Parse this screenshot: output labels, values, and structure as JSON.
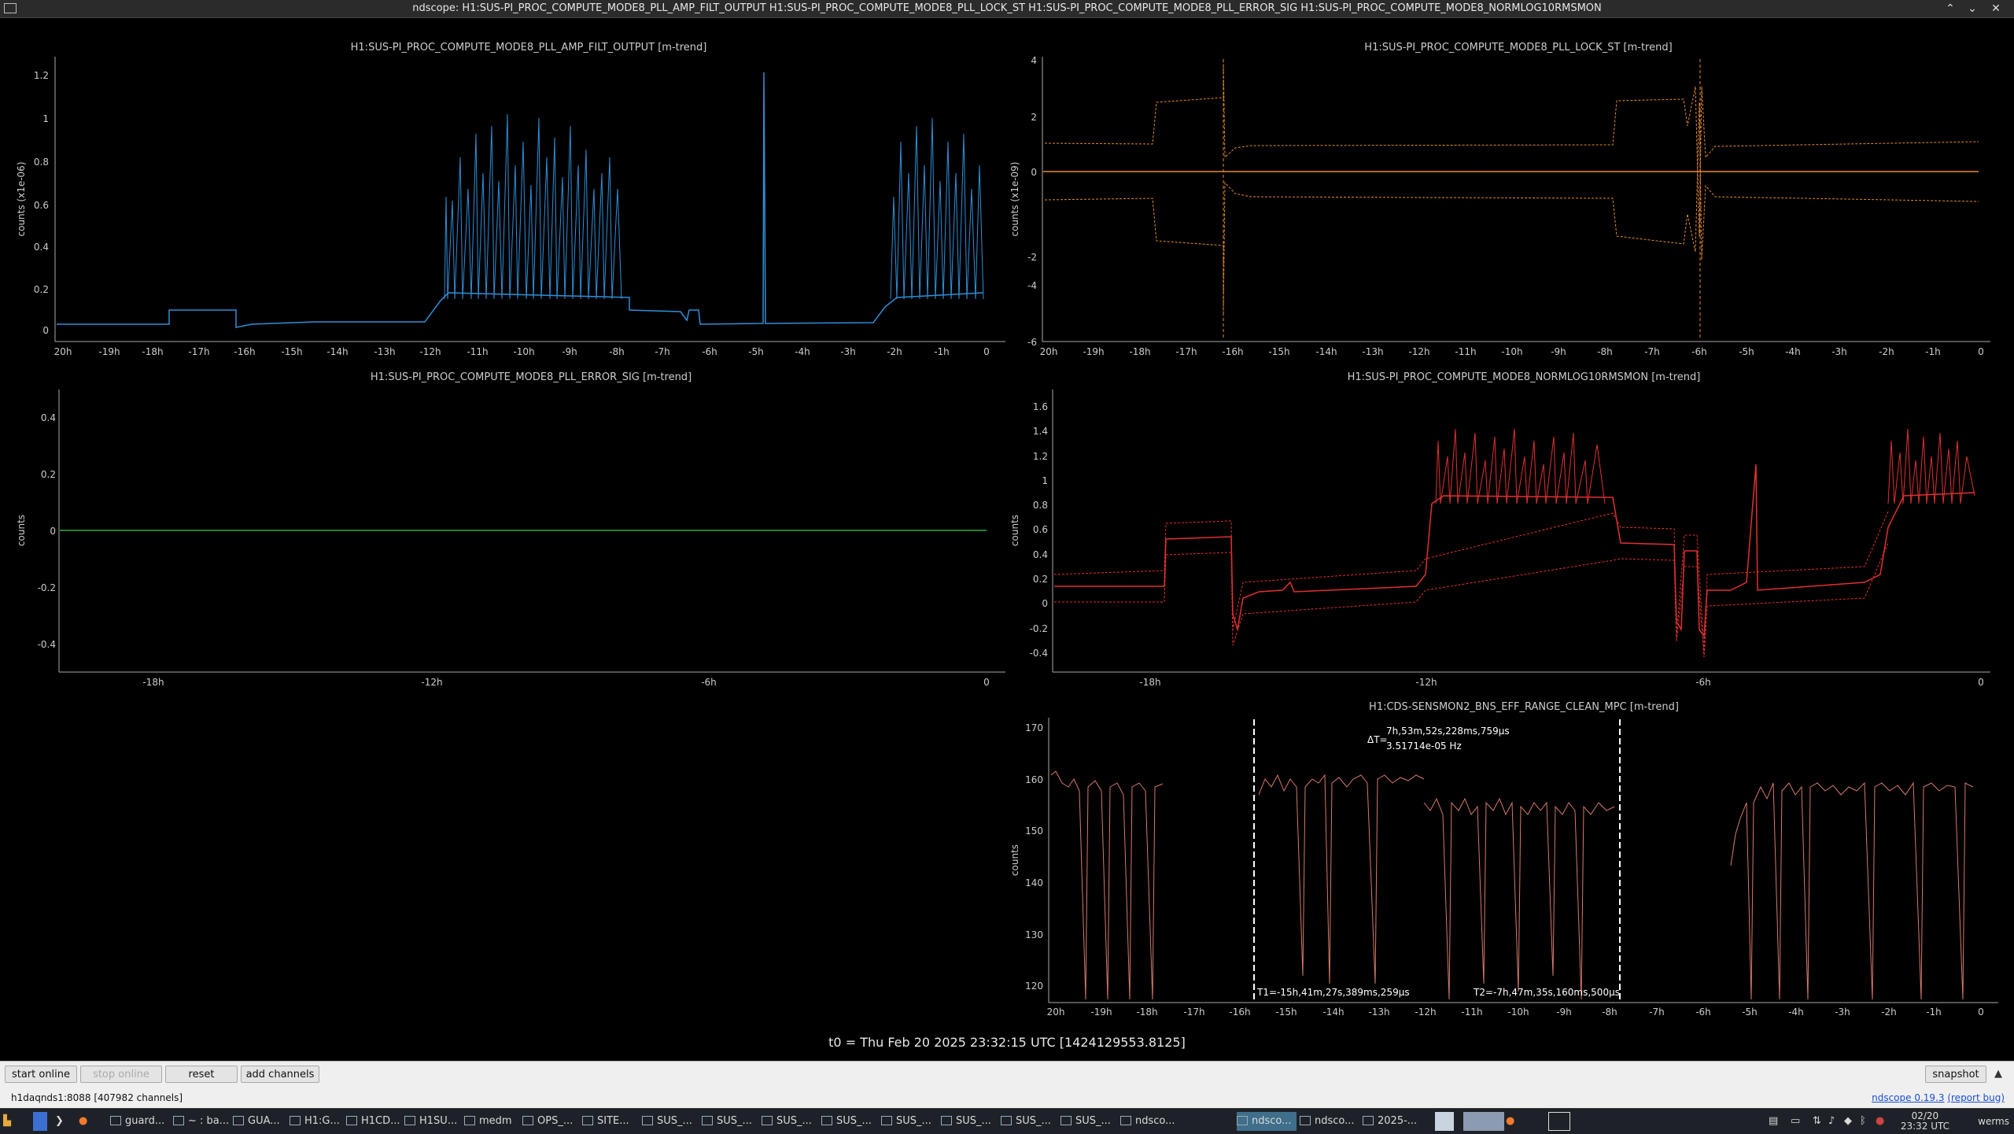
{
  "window": {
    "title": "ndscope: H1:SUS-PI_PROC_COMPUTE_MODE8_PLL_AMP_FILT_OUTPUT H1:SUS-PI_PROC_COMPUTE_MODE8_PLL_LOCK_ST H1:SUS-PI_PROC_COMPUTE_MODE8_PLL_ERROR_SIG H1:SUS-PI_PROC_COMPUTE_MODE8_NORMLOG10RMSMON",
    "controls": [
      "⌃",
      "⌄",
      "✕"
    ]
  },
  "plots": [
    {
      "title": "H1:SUS-PI_PROC_COMPUTE_MODE8_PLL_AMP_FILT_OUTPUT [m-trend]",
      "ylabel": "counts (x1e-06)",
      "color": "#2f8fd8",
      "yticks": [
        "0",
        "0.2",
        "0.4",
        "0.6",
        "0.8",
        "1",
        "1.2"
      ],
      "xticks": [
        "20h",
        "-19h",
        "-18h",
        "-17h",
        "-16h",
        "-15h",
        "-14h",
        "-13h",
        "-12h",
        "-11h",
        "-10h",
        "-9h",
        "-8h",
        "-7h",
        "-6h",
        "-5h",
        "-4h",
        "-3h",
        "-2h",
        "-1h",
        "0"
      ]
    },
    {
      "title": "H1:SUS-PI_PROC_COMPUTE_MODE8_PLL_LOCK_ST [m-trend]",
      "ylabel": "counts (x1e-09)",
      "color": "#e58a2b",
      "yticks": [
        "-6",
        "-4",
        "-2",
        "0",
        "2",
        "4"
      ],
      "xticks": [
        "20h",
        "-19h",
        "-18h",
        "-17h",
        "-16h",
        "-15h",
        "-14h",
        "-13h",
        "-12h",
        "-11h",
        "-10h",
        "-9h",
        "-8h",
        "-7h",
        "-6h",
        "-5h",
        "-4h",
        "-3h",
        "-2h",
        "-1h",
        "0"
      ]
    },
    {
      "title": "H1:SUS-PI_PROC_COMPUTE_MODE8_PLL_ERROR_SIG [m-trend]",
      "ylabel": "counts",
      "color": "#2fae4a",
      "yticks": [
        "-0.4",
        "-0.2",
        "0",
        "0.2",
        "0.4"
      ],
      "xticks": [
        "-18h",
        "-12h",
        "-6h",
        "0"
      ]
    },
    {
      "title": "H1:SUS-PI_PROC_COMPUTE_MODE8_NORMLOG10RMSMON [m-trend]",
      "ylabel": "counts",
      "color": "#e03030",
      "yticks": [
        "-0.4",
        "-0.2",
        "0",
        "0.2",
        "0.4",
        "0.6",
        "0.8",
        "1",
        "1.2",
        "1.4",
        "1.6"
      ],
      "xticks": [
        "-18h",
        "-12h",
        "-6h",
        "0"
      ]
    },
    {
      "title": "H1:CDS-SENSMON2_BNS_EFF_RANGE_CLEAN_MPC [m-trend]",
      "ylabel": "counts",
      "color": "#d67a6a",
      "yticks": [
        "120",
        "130",
        "140",
        "150",
        "160",
        "170"
      ],
      "xticks": [
        "20h",
        "-19h",
        "-18h",
        "-17h",
        "-16h",
        "-15h",
        "-14h",
        "-13h",
        "-12h",
        "-11h",
        "-10h",
        "-9h",
        "-8h",
        "-7h",
        "-6h",
        "-5h",
        "-4h",
        "-3h",
        "-2h",
        "-1h",
        "0"
      ]
    }
  ],
  "cursors": {
    "delta_label": "ΔT=",
    "delta_time": "7h,53m,52s,228ms,759μs",
    "delta_freq": "3.51714e-05 Hz",
    "t1": "T1=-15h,41m,27s,389ms,259μs",
    "t2": "T2=-7h,47m,35s,160ms,500μs"
  },
  "t0": "t0 = Thu Feb 20 2025 23:32:15 UTC [1424129553.8125]",
  "buttons": {
    "start_online": "start online",
    "stop_online": "stop online",
    "reset": "reset",
    "add_channels": "add channels",
    "snapshot": "snapshot"
  },
  "status": {
    "server": "h1daqnds1:8088  [407982 channels]",
    "version_link": "ndscope 0.19.3",
    "report": "(report bug)"
  },
  "taskbar": {
    "items": [
      "guard...",
      "~ : ba...",
      "GUA...",
      "H1:G...",
      "H1CD...",
      "H1SU...",
      "medm",
      "OPS_...",
      "SITE...",
      "SUS_...",
      "SUS_...",
      "SUS_...",
      "SUS_...",
      "SUS_...",
      "SUS_...",
      "SUS_...",
      "SUS_...",
      "ndsco...",
      "ndsco...",
      "ndsco...",
      "2025-..."
    ],
    "clock_date": "02/20",
    "clock_time": "23:32 UTC",
    "user": "werms"
  }
}
